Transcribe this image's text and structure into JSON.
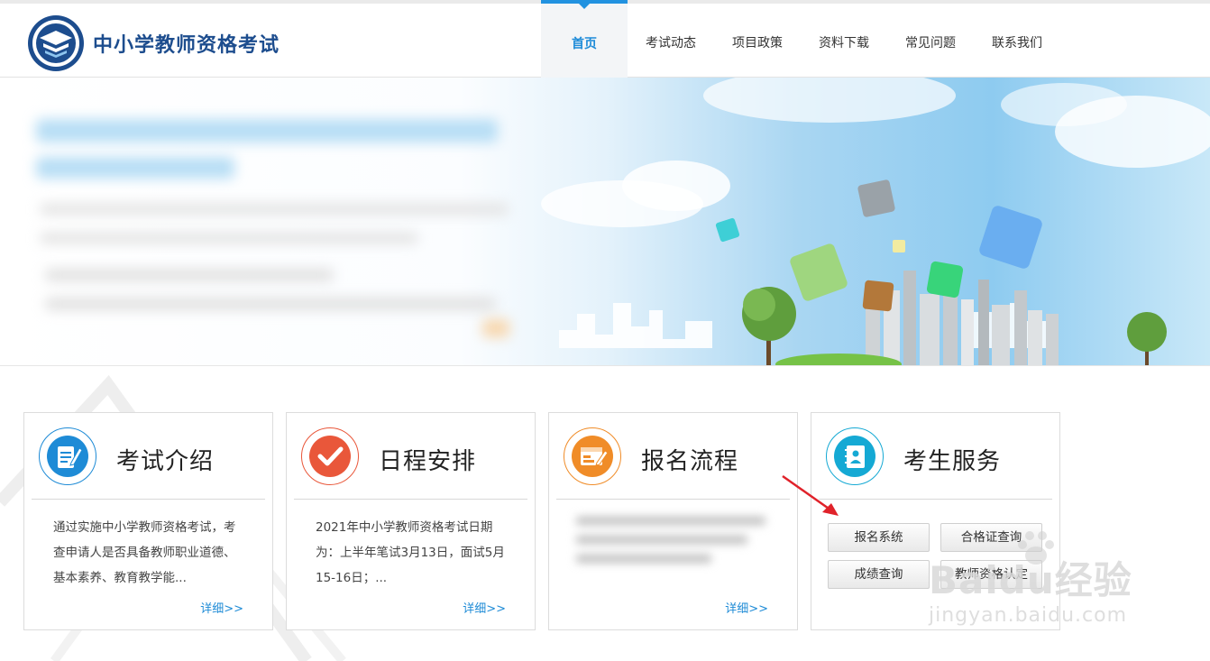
{
  "header": {
    "site_title": "中小学教师资格考试",
    "nav": [
      "首页",
      "考试动态",
      "项目政策",
      "资料下载",
      "常见问题",
      "联系我们"
    ],
    "active_nav": "首页"
  },
  "cards": [
    {
      "title": "考试介绍",
      "icon": "document-edit-icon",
      "color": "#1e8bd6",
      "text": "通过实施中小学教师资格考试，考查申请人是否具备教师职业道德、基本素养、教育教学能...",
      "more": "详细>>"
    },
    {
      "title": "日程安排",
      "icon": "checkmark-icon",
      "color": "#e9573a",
      "text": "2021年中小学教师资格考试日期为：上半年笔试3月13日，面试5月15-16日；...",
      "more": "详细>>"
    },
    {
      "title": "报名流程",
      "icon": "form-pen-icon",
      "color": "#f08c28",
      "text": "",
      "more": "详细>>"
    },
    {
      "title": "考生服务",
      "icon": "contact-book-icon",
      "color": "#15a9d4",
      "buttons": [
        "报名系统",
        "合格证查询",
        "成绩查询",
        "教师资格认定"
      ]
    }
  ],
  "watermark": {
    "brand": "Baidu经验",
    "url": "jingyan.baidu.com"
  },
  "colors": {
    "primary": "#1d8bd8",
    "title": "#1d4d8e",
    "arrow": "#e0222a"
  }
}
